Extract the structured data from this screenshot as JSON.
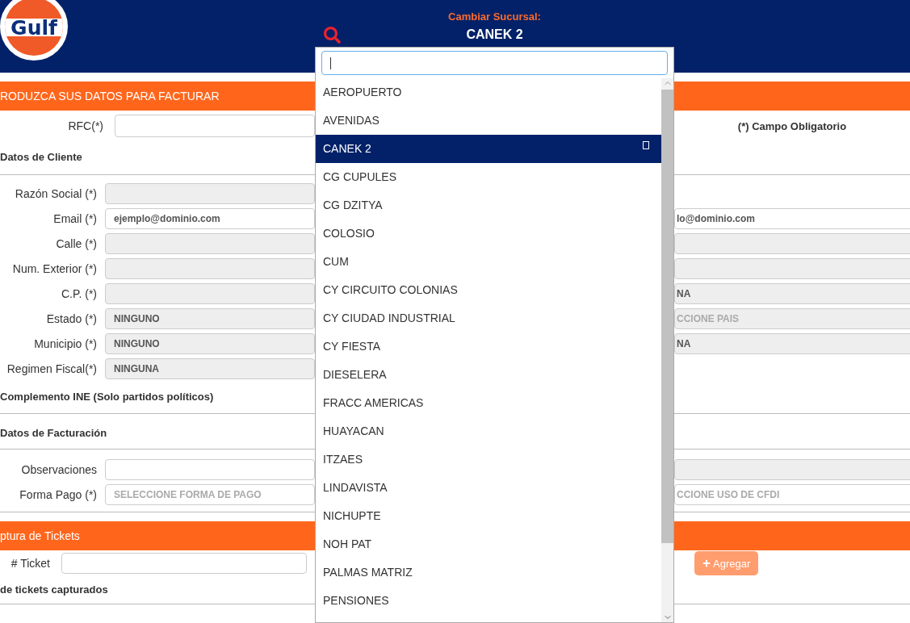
{
  "header": {
    "logo_text": "Gulf",
    "branch_label": "Cambiar Sucursal:",
    "branch_name": "CANEK 2"
  },
  "branch_dropdown": {
    "items": [
      {
        "label": "AEROPUERTO",
        "selected": false
      },
      {
        "label": "AVENIDAS",
        "selected": false
      },
      {
        "label": "CANEK 2",
        "selected": true
      },
      {
        "label": "CG CUPULES",
        "selected": false
      },
      {
        "label": "CG DZITYA",
        "selected": false
      },
      {
        "label": "COLOSIO",
        "selected": false
      },
      {
        "label": "CUM",
        "selected": false
      },
      {
        "label": "CY CIRCUITO COLONIAS",
        "selected": false
      },
      {
        "label": "CY CIUDAD INDUSTRIAL",
        "selected": false
      },
      {
        "label": "CY FIESTA",
        "selected": false
      },
      {
        "label": "DIESELERA",
        "selected": false
      },
      {
        "label": "FRACC AMERICAS",
        "selected": false
      },
      {
        "label": "HUAYACAN",
        "selected": false
      },
      {
        "label": "ITZAES",
        "selected": false
      },
      {
        "label": "LINDAVISTA",
        "selected": false
      },
      {
        "label": "NICHUPTE",
        "selected": false
      },
      {
        "label": "NOH PAT",
        "selected": false
      },
      {
        "label": "PALMAS MATRIZ",
        "selected": false
      },
      {
        "label": "PENSIONES",
        "selected": false
      }
    ]
  },
  "invoice": {
    "title": "RODUZCA SUS DATOS PARA FACTURAR",
    "rfc_label": "RFC(*)",
    "required_note": "(*) Campo Obligatorio",
    "client_title": "Datos de Cliente",
    "client_rows": [
      {
        "label": "Razón Social (*)",
        "disabled": true
      },
      {
        "label": "Email (*)",
        "value": "ejemplo@dominio.com",
        "disabled": false,
        "right": {
          "value": "lo@dominio.com",
          "disabled": false
        }
      },
      {
        "label": "Calle (*)",
        "disabled": true,
        "right": {
          "disabled": true
        }
      },
      {
        "label": "Num. Exterior (*)",
        "disabled": true,
        "right": {
          "disabled": true
        }
      },
      {
        "label": "C.P. (*)",
        "disabled": true,
        "right": {
          "value": "NA",
          "disabled": true
        }
      },
      {
        "label": "Estado (*)",
        "value": "NINGUNO",
        "disabled": true,
        "right": {
          "placeholder": "CCIONE PAIS",
          "disabled": true
        }
      },
      {
        "label": "Municipio (*)",
        "value": "NINGUNO",
        "disabled": true,
        "right": {
          "value": "NA",
          "disabled": true
        }
      },
      {
        "label": "Regimen Fiscal(*)",
        "value": "NINGUNA",
        "disabled": true
      }
    ],
    "ine_title": "Complemento INE (Solo partidos políticos)",
    "billing_title": "Datos de Facturación",
    "billing_rows": [
      {
        "label": "Observaciones",
        "disabled": false,
        "right": {
          "disabled": true
        }
      },
      {
        "label": "Forma Pago (*)",
        "placeholder": "SELECCIONE FORMA DE PAGO",
        "disabled": false,
        "right": {
          "placeholder": "CCIONE USO DE CFDI",
          "disabled": false
        }
      }
    ]
  },
  "tickets": {
    "title": "ptura de Tickets",
    "ticket_label": "# Ticket",
    "add_button": "Agregar",
    "list_title": "de tickets capturados"
  }
}
